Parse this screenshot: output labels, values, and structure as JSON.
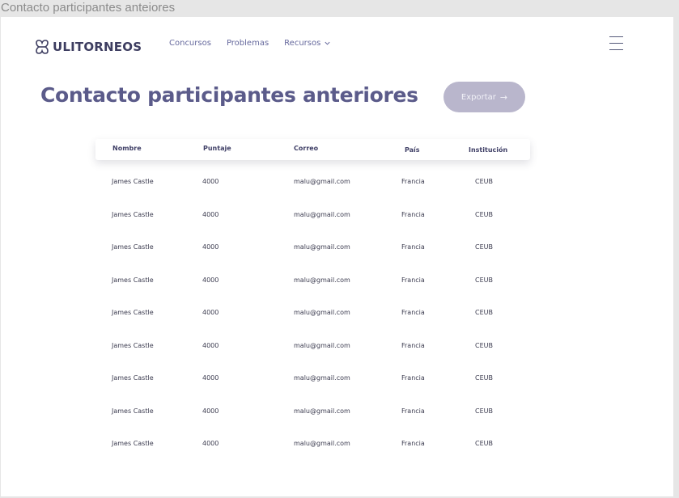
{
  "window": {
    "title": "Contacto participantes anteiores"
  },
  "header": {
    "logo_text": "ULITORNEOS",
    "nav": [
      {
        "label": "Concursos"
      },
      {
        "label": "Problemas"
      },
      {
        "label": "Recursos"
      }
    ]
  },
  "page": {
    "title": "Contacto participantes anteriores",
    "export_label": "Exportar"
  },
  "table": {
    "columns": [
      "Nombre",
      "Puntaje",
      "Correo",
      "País",
      "Institución"
    ],
    "rows": [
      [
        "James Castle",
        "4000",
        "malu@gmail.com",
        "Francia",
        "CEUB"
      ],
      [
        "James Castle",
        "4000",
        "malu@gmail.com",
        "Francia",
        "CEUB"
      ],
      [
        "James Castle",
        "4000",
        "malu@gmail.com",
        "Francia",
        "CEUB"
      ],
      [
        "James Castle",
        "4000",
        "malu@gmail.com",
        "Francia",
        "CEUB"
      ],
      [
        "James Castle",
        "4000",
        "malu@gmail.com",
        "Francia",
        "CEUB"
      ],
      [
        "James Castle",
        "4000",
        "malu@gmail.com",
        "Francia",
        "CEUB"
      ],
      [
        "James Castle",
        "4000",
        "malu@gmail.com",
        "Francia",
        "CEUB"
      ],
      [
        "James Castle",
        "4000",
        "malu@gmail.com",
        "Francia",
        "CEUB"
      ],
      [
        "James Castle",
        "4000",
        "malu@gmail.com",
        "Francia",
        "CEUB"
      ]
    ]
  },
  "colors": {
    "brand": "#3d3d60",
    "title": "#5b5b8a",
    "nav": "#66699d",
    "button_bg": "#b9b6cc"
  },
  "icons": [
    "logo-icon",
    "chevron-down-icon",
    "arrow-right-icon",
    "hamburger-menu-icon"
  ]
}
